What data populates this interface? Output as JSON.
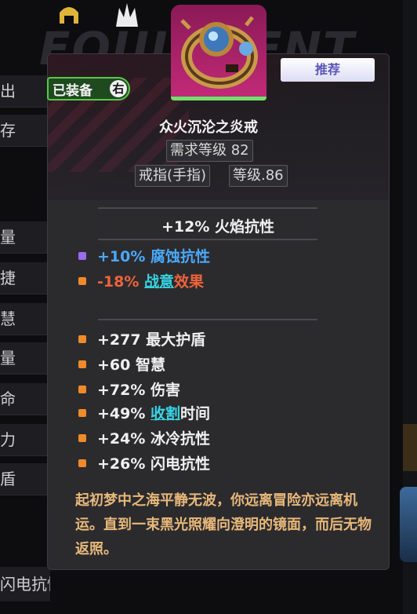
{
  "background": {
    "title": "EQUIPMENT",
    "left_stats": [
      "出",
      "存",
      "量",
      "捷",
      "慧",
      "量",
      "命",
      "力",
      "盾"
    ],
    "bottom_stat": "闪电抗性"
  },
  "tooltip": {
    "recommend_tag": "推荐",
    "equipped_label": "已装备",
    "equipped_side": "右",
    "item_name": "众火沉沦之炎戒",
    "required_level": "需求等级 82",
    "item_type": "戒指(手指)",
    "item_level": "等级.86",
    "main_stat": "+12% 火焰抗性",
    "special_affixes": [
      {
        "value": "+10%",
        "text": "腐蚀抗性",
        "dot": "purple"
      },
      {
        "value": "-18%",
        "keyword": "战意",
        "text": "效果",
        "dot": "orange"
      }
    ],
    "affixes": [
      {
        "value": "+277",
        "text": "最大护盾"
      },
      {
        "value": "+60",
        "text": "智慧"
      },
      {
        "value": "+72%",
        "text": "伤害"
      },
      {
        "value": "+49%",
        "keyword": "收割",
        "text": "时间"
      },
      {
        "value": "+24%",
        "text": "冰冷抗性"
      },
      {
        "value": "+26%",
        "text": "闪电抗性"
      }
    ],
    "lore": "起初梦中之海平静无波，你远离冒险亦远离机运。直到一束黑光照耀向澄明的镜面，而后无物返照。"
  },
  "colors": {
    "accent_green": "#59c84b",
    "portrait_magenta": "#c42a78",
    "affix_blue": "#4aa8f8",
    "affix_red": "#f0633a",
    "keyword_cyan": "#35d6e6",
    "lore_gold": "#e8b87a"
  }
}
